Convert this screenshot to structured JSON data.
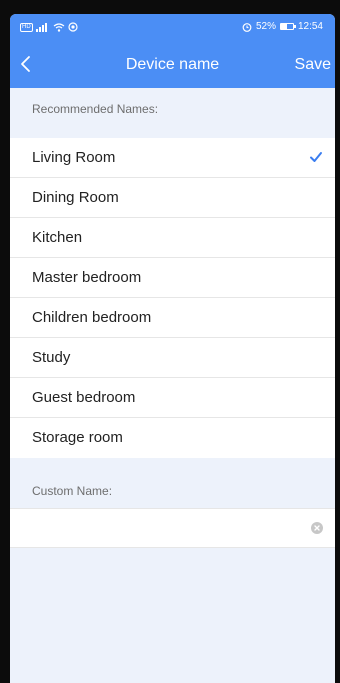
{
  "status_bar": {
    "left_icons": [
      "hd-icon",
      "signal-icon",
      "wifi-icon",
      "location-icon"
    ],
    "hd_label": "HD",
    "alarm_icon": "alarm-icon",
    "battery_percent": "52%",
    "battery_level": 0.52,
    "time": "12:54"
  },
  "nav": {
    "back_icon": "chevron-left-icon",
    "title": "Device name",
    "save_label": "Save"
  },
  "recommended": {
    "label": "Recommended Names:",
    "items": [
      {
        "label": "Living Room",
        "selected": true
      },
      {
        "label": "Dining Room",
        "selected": false
      },
      {
        "label": "Kitchen",
        "selected": false
      },
      {
        "label": "Master bedroom",
        "selected": false
      },
      {
        "label": "Children bedroom",
        "selected": false
      },
      {
        "label": "Study",
        "selected": false
      },
      {
        "label": "Guest bedroom",
        "selected": false
      },
      {
        "label": "Storage room",
        "selected": false
      }
    ]
  },
  "custom": {
    "label": "Custom Name:",
    "value": "",
    "placeholder": "",
    "clear_icon": "clear-icon"
  },
  "colors": {
    "header": "#4b8ef5",
    "accent": "#3a7df0",
    "page_background": "#edf2fb",
    "frame": "#0c0c0c"
  }
}
